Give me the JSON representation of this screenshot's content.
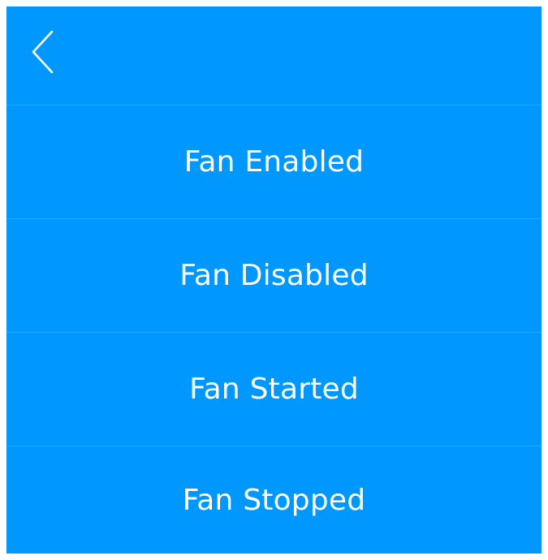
{
  "colors": {
    "background": "#0098ff",
    "text": "#ffffff",
    "divider": "#2aa7ff"
  },
  "header": {
    "back_icon": "chevron-left-icon"
  },
  "menu": {
    "items": [
      {
        "label": "Fan Enabled"
      },
      {
        "label": "Fan Disabled"
      },
      {
        "label": "Fan Started"
      },
      {
        "label": "Fan Stopped"
      }
    ]
  }
}
